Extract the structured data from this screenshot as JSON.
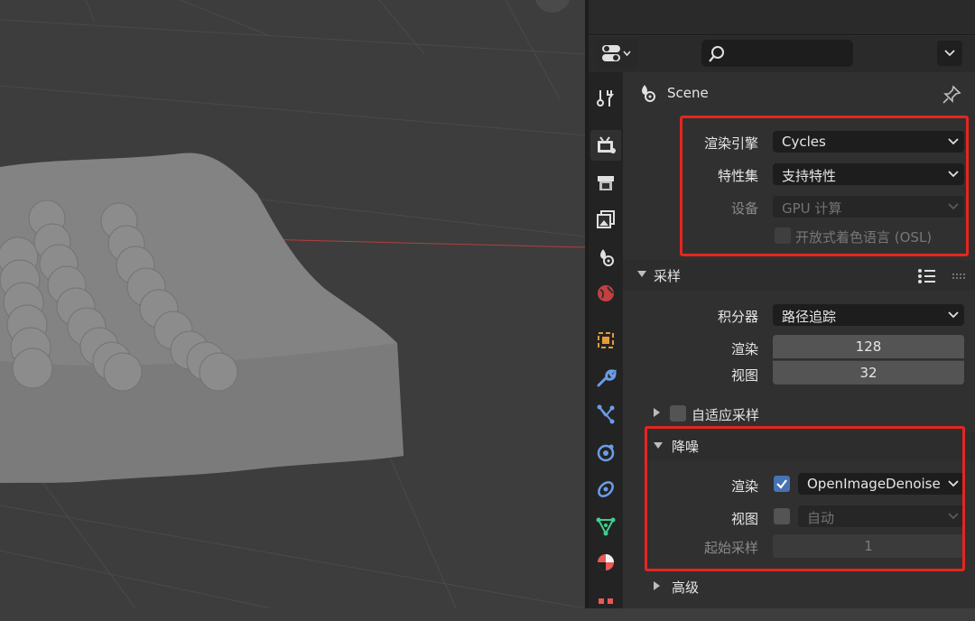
{
  "properties_panel": {
    "context_title": "Scene",
    "render": {
      "engine_label": "渲染引擎",
      "engine_value": "Cycles",
      "feature_set_label": "特性集",
      "feature_set_value": "支持特性",
      "device_label": "设备",
      "device_value": "GPU 计算",
      "osl_label": "开放式着色语言 (OSL)"
    },
    "sampling": {
      "title": "采样",
      "integrator_label": "积分器",
      "integrator_value": "路径追踪",
      "render_label": "渲染",
      "render_value": "128",
      "viewport_label": "视图",
      "viewport_value": "32",
      "adaptive_label": "自适应采样"
    },
    "denoising": {
      "title": "降噪",
      "render_label": "渲染",
      "render_checked": true,
      "render_value": "OpenImageDenoise",
      "viewport_label": "视图",
      "viewport_checked": false,
      "viewport_value": "自动",
      "start_sample_label": "起始采样",
      "start_sample_value": "1"
    },
    "advanced": {
      "title": "高级"
    }
  },
  "tabs": [
    {
      "icon": "tool-icon"
    },
    {
      "icon": "render-icon",
      "active": true
    },
    {
      "icon": "output-icon"
    },
    {
      "icon": "view-layer-icon"
    },
    {
      "icon": "scene-icon"
    },
    {
      "icon": "world-icon"
    },
    {
      "icon": "object-icon"
    },
    {
      "icon": "modifier-icon"
    },
    {
      "icon": "particles-icon"
    },
    {
      "icon": "physics-icon"
    },
    {
      "icon": "constraints-icon"
    },
    {
      "icon": "data-icon"
    },
    {
      "icon": "material-icon"
    },
    {
      "icon": "texture-icon"
    }
  ],
  "colors": {
    "highlight_box": "#e5261f",
    "checkbox_checked": "#4772b3",
    "x_axis_line": "#b04040"
  }
}
